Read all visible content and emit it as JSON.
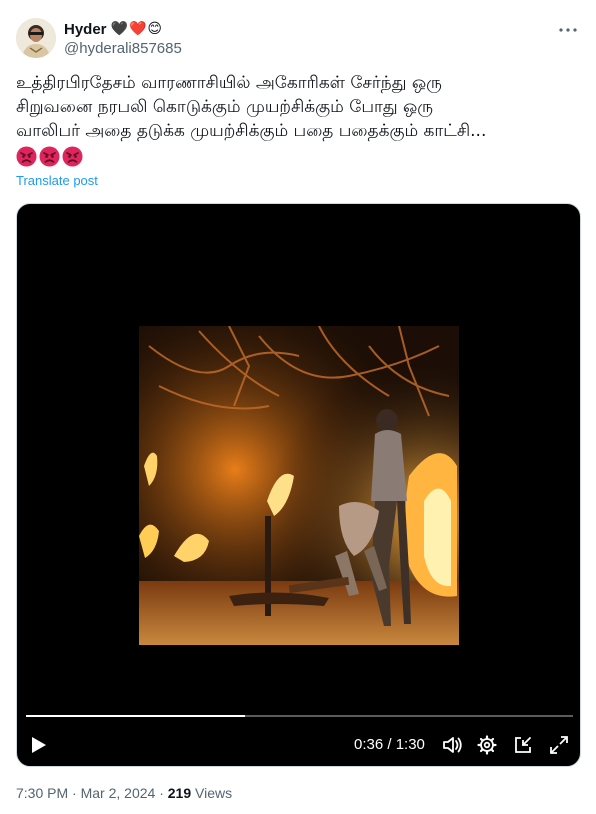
{
  "author": {
    "display_name": "Hyder",
    "name_emoji": "🖤❤️😊",
    "handle": "@hyderali857685",
    "avatar_icon": "profile-photo"
  },
  "tweet": {
    "text": "உத்திரபிரதேசம் வாரணாசியில் அகோரிகள் சேர்ந்து ஒரு\nசிறுவனை நரபலி கொடுக்கும் முயற்சிக்கும் போது ஒரு\nவாலிபர் அதை தடுக்க முயற்சிக்கும் பதை பதைக்கும் காட்சி...",
    "emojis": [
      "angry-face",
      "angry-face",
      "angry-face"
    ],
    "translate_label": "Translate post"
  },
  "video": {
    "current_time": "0:36",
    "duration": "1:30",
    "time_label": "0:36 / 1:30",
    "progress_fraction": 0.4,
    "accent": "#ffffff"
  },
  "footer": {
    "time": "7:30 PM",
    "date": "Mar 2, 2024",
    "separator": "·",
    "views_count": "219",
    "views_label": "Views"
  },
  "colors": {
    "link": "#1d9bf0",
    "secondary_text": "#536471",
    "primary_text": "#0f1419"
  }
}
